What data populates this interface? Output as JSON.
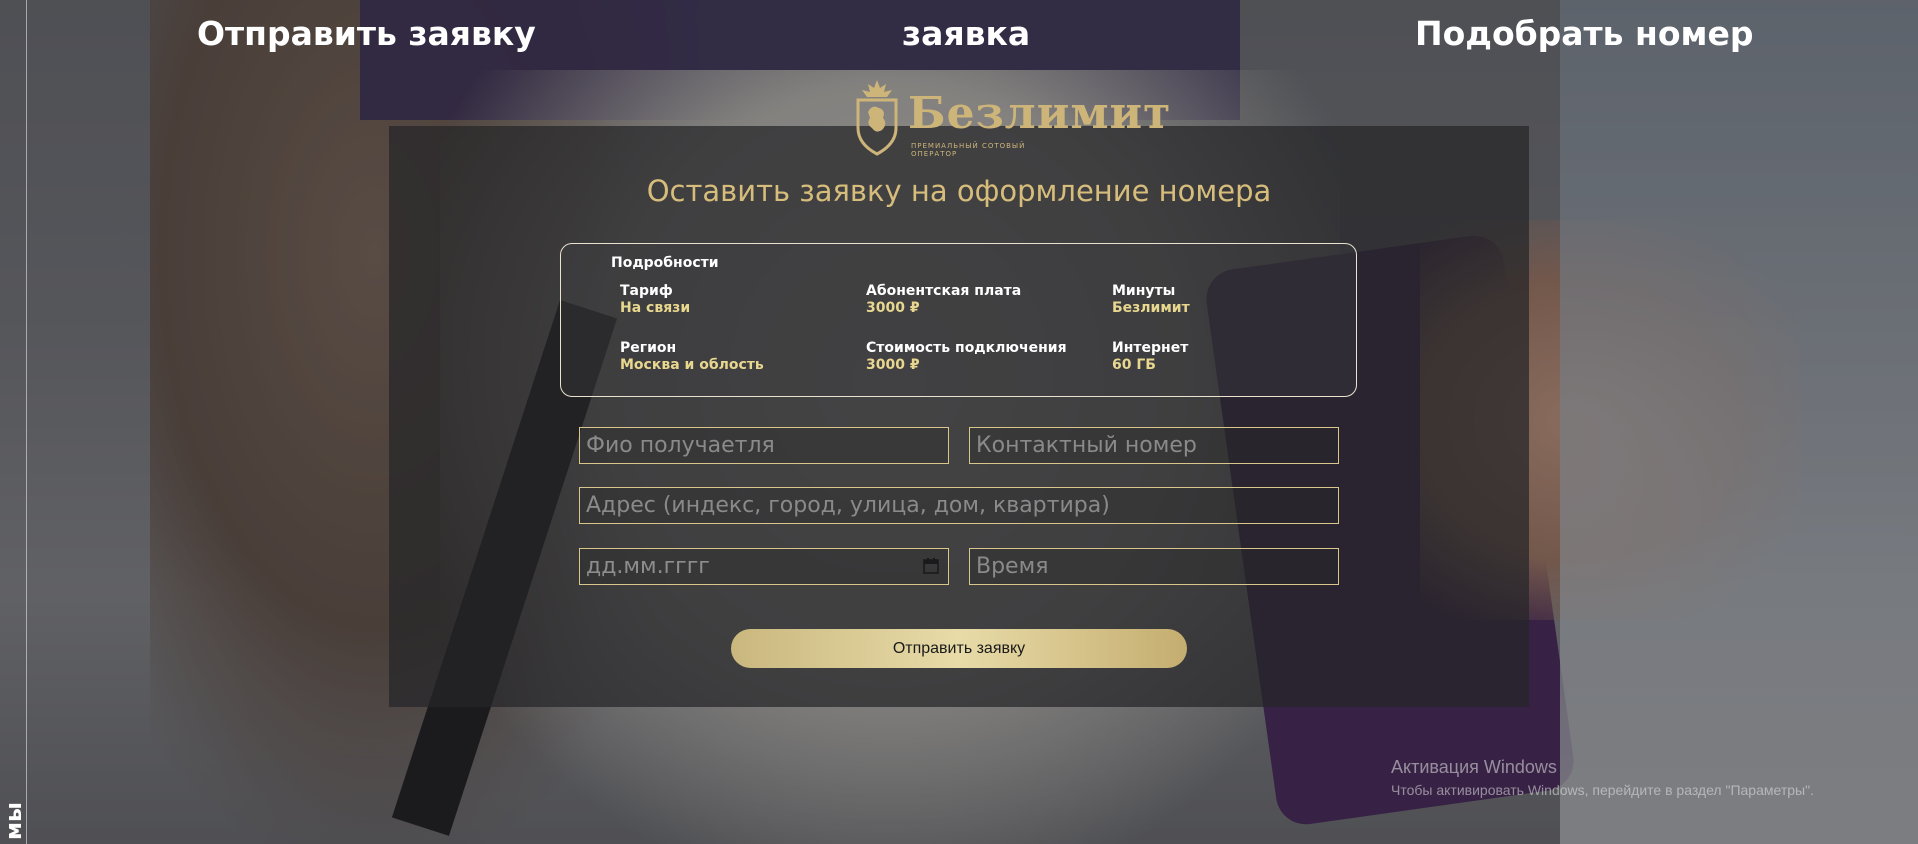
{
  "nav": {
    "link_1": "Отправить заявку",
    "link_2": "заявка",
    "link_3": "Подобрать номер"
  },
  "rail": {
    "text": "мы"
  },
  "logo": {
    "brand": "Безлимит",
    "tagline": "ПРЕМИАЛЬНЫЙ СОТОВЫЙ ОПЕРАТОР",
    "icon": "lion-crest-icon"
  },
  "form": {
    "title": "Оставить заявку на оформление номера",
    "details": {
      "heading": "Подробности",
      "items": [
        {
          "label": "Тариф",
          "value": "На связи"
        },
        {
          "label": "Абонентская плата",
          "value": "3000 ₽"
        },
        {
          "label": "Минуты",
          "value": "Безлимит"
        },
        {
          "label": "Регион",
          "value": "Москва и облость"
        },
        {
          "label": "Стоимость подключения",
          "value": "3000 ₽"
        },
        {
          "label": "Интернет",
          "value": "60 ГБ"
        }
      ]
    },
    "fields": {
      "name_placeholder": "Фио получаетля",
      "phone_placeholder": "Контактный номер",
      "address_placeholder": "Адрес (индекс, город, улица, дом, квартира)",
      "date_placeholder": "дд.мм.гггг",
      "time_placeholder": "Время"
    },
    "submit_label": "Отправить заявку"
  },
  "windows_watermark": {
    "title": "Активация Windows",
    "subtitle": "Чтобы активировать Windows, перейдите в раздел \"Параметры\"."
  },
  "colors": {
    "accent_gold": "#d7bd7c",
    "value_gold": "#e8d78f",
    "field_border": "#d9c68a"
  }
}
